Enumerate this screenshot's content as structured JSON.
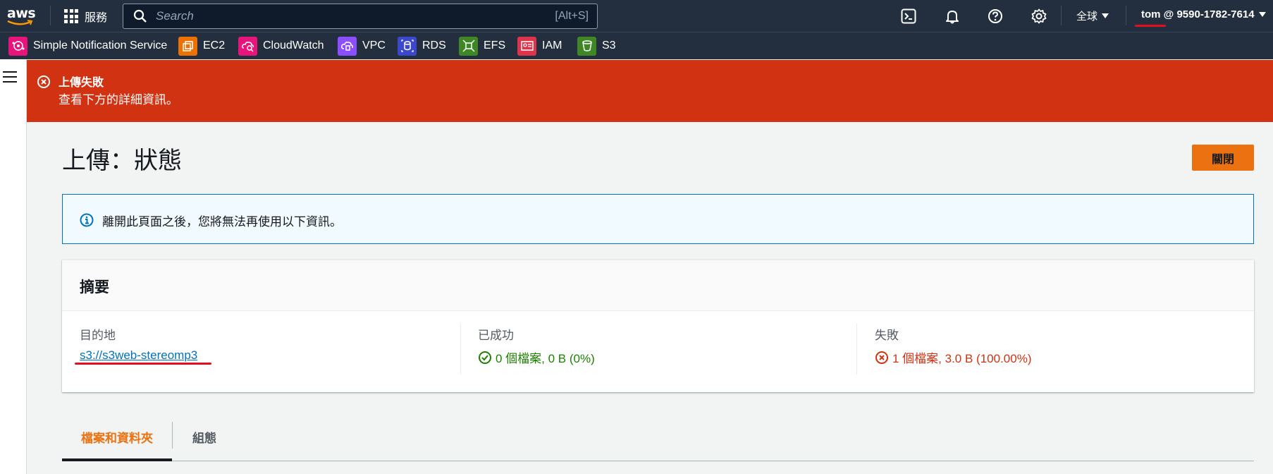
{
  "topnav": {
    "logo_text": "aws",
    "services_label": "服務",
    "search_placeholder": "Search",
    "search_shortcut": "[Alt+S]",
    "icons": [
      "cloudshell-icon",
      "notifications-icon",
      "help-icon",
      "settings-icon"
    ],
    "region_label": "全球",
    "account_label": "tom @ 9590-1782-7614"
  },
  "favorites": [
    {
      "label": "Simple Notification Service",
      "icon": "sns-icon",
      "color": "#e7157b"
    },
    {
      "label": "EC2",
      "icon": "ec2-icon",
      "color": "#ed7100"
    },
    {
      "label": "CloudWatch",
      "icon": "cloudwatch-icon",
      "color": "#e7157b"
    },
    {
      "label": "VPC",
      "icon": "vpc-icon",
      "color": "#8c4fff"
    },
    {
      "label": "RDS",
      "icon": "rds-icon",
      "color": "#3b48cc"
    },
    {
      "label": "EFS",
      "icon": "efs-icon",
      "color": "#3f8624"
    },
    {
      "label": "IAM",
      "icon": "iam-icon",
      "color": "#dd344c"
    },
    {
      "label": "S3",
      "icon": "s3-icon",
      "color": "#3f8624"
    }
  ],
  "flash": {
    "title": "上傳失敗",
    "message": "查看下方的詳細資訊。",
    "color": "#d13212"
  },
  "page": {
    "title": "上傳：狀態",
    "close_button": "關閉"
  },
  "info_alert": {
    "text": "離開此頁面之後，您將無法再使用以下資訊。"
  },
  "summary": {
    "heading": "摘要",
    "destination_label": "目的地",
    "destination_value": "s3://s3web-stereomp3",
    "succeeded_label": "已成功",
    "succeeded_value": "0 個檔案, 0 B (0%)",
    "failed_label": "失敗",
    "failed_value": "1 個檔案, 3.0 B (100.00%)"
  },
  "tabs": [
    {
      "label": "檔案和資料夾",
      "active": true
    },
    {
      "label": "組態",
      "active": false
    }
  ]
}
